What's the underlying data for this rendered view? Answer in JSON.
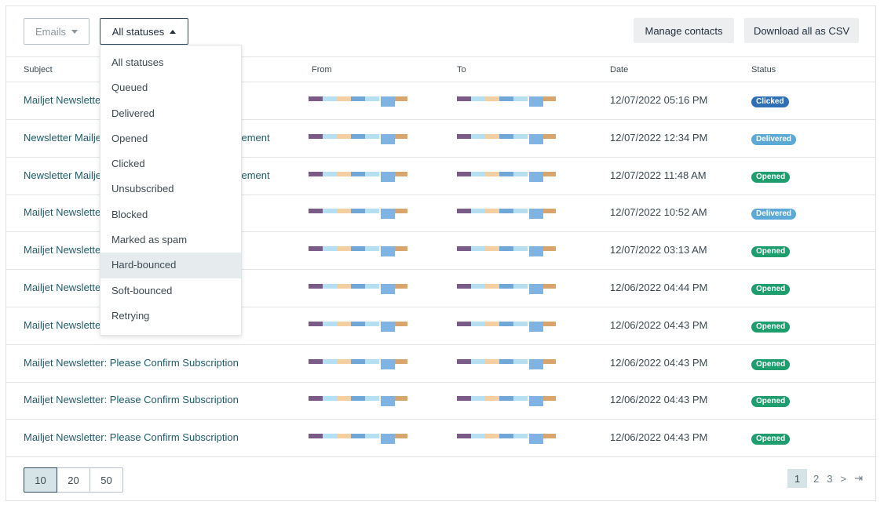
{
  "toolbar": {
    "emails_label": "Emails",
    "status_label": "All statuses",
    "manage_label": "Manage contacts",
    "download_label": "Download all as CSV"
  },
  "table": {
    "headers": {
      "subject": "Subject",
      "from": "From",
      "to": "To",
      "date": "Date",
      "status": "Status"
    },
    "rows": [
      {
        "subject": "Mailjet Newsletter: Please Confirm Subscription",
        "date": "12/07/2022 05:16 PM",
        "status": "Clicked"
      },
      {
        "subject": "Newsletter Mailjet : Confirmation de votre abonnement",
        "date": "12/07/2022 12:34 PM",
        "status": "Delivered"
      },
      {
        "subject": "Newsletter Mailjet : Confirmation de votre abonnement",
        "date": "12/07/2022 11:48 AM",
        "status": "Opened"
      },
      {
        "subject": "Mailjet Newsletter: Please Confirm Subscription",
        "date": "12/07/2022 10:52 AM",
        "status": "Delivered"
      },
      {
        "subject": "Mailjet Newsletter: Please Confirm Subscription",
        "date": "12/07/2022 03:13 AM",
        "status": "Opened"
      },
      {
        "subject": "Mailjet Newsletter: Please Confirm Subscription",
        "date": "12/06/2022 04:44 PM",
        "status": "Opened"
      },
      {
        "subject": "Mailjet Newsletter: Please Confirm Subscription",
        "date": "12/06/2022 04:43 PM",
        "status": "Opened"
      },
      {
        "subject": "Mailjet Newsletter: Please Confirm Subscription",
        "date": "12/06/2022 04:43 PM",
        "status": "Opened"
      },
      {
        "subject": "Mailjet Newsletter: Please Confirm Subscription",
        "date": "12/06/2022 04:43 PM",
        "status": "Opened"
      },
      {
        "subject": "Mailjet Newsletter: Please Confirm Subscription",
        "date": "12/06/2022 04:43 PM",
        "status": "Opened"
      }
    ]
  },
  "status_colors": {
    "Clicked": "#2f6fb5",
    "Delivered": "#5aa9d6",
    "Opened": "#1e9e6e"
  },
  "redaction_colors": [
    "#7a5a86",
    "#b7dff2",
    "#f5cfa0",
    "#6fa8d8",
    "#b7dff2",
    "#fdf3d8",
    "#d9a56e"
  ],
  "dropdown": {
    "items": [
      "All statuses",
      "Queued",
      "Delivered",
      "Opened",
      "Clicked",
      "Unsubscribed",
      "Blocked",
      "Marked as spam",
      "Hard-bounced",
      "Soft-bounced",
      "Retrying"
    ],
    "hovered_item": "Hard-bounced"
  },
  "pagination": {
    "page_sizes": [
      "10",
      "20",
      "50"
    ],
    "selected_size": "10",
    "pages": [
      "1",
      "2",
      "3"
    ],
    "current_page": "1",
    "next_symbol": ">",
    "last_symbol": "⇥"
  }
}
